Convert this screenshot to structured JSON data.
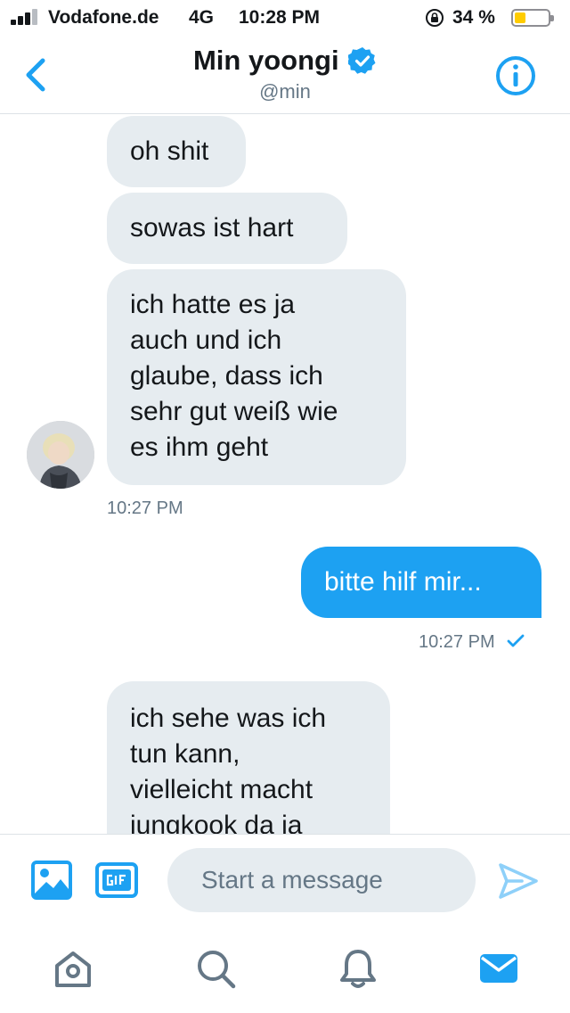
{
  "status_bar": {
    "carrier": "Vodafone.de",
    "network": "4G",
    "time": "10:28 PM",
    "battery_percent": "34 %",
    "battery_level": 0.34,
    "battery_color": "#ffcc00"
  },
  "header": {
    "title": "Min yoongi",
    "handle": "@min",
    "accent": "#1da1f2"
  },
  "messages": [
    {
      "direction": "received",
      "text": "oh shit"
    },
    {
      "direction": "received",
      "text": "sowas ist hart"
    },
    {
      "direction": "received",
      "lines": [
        "ich hatte es ja",
        "auch und ich",
        "glaube, dass ich",
        "sehr gut weiß wie",
        "es ihm geht"
      ]
    },
    {
      "direction": "received_timestamp",
      "text": "10:27 PM"
    },
    {
      "direction": "sent",
      "text": "bitte hilf mir..."
    },
    {
      "direction": "sent_timestamp",
      "text": "10:27 PM"
    },
    {
      "direction": "received",
      "lines": [
        "ich sehe was ich",
        "tun kann,",
        "vielleicht macht",
        "jungkook da ja"
      ]
    }
  ],
  "composer": {
    "placeholder": "Start a message",
    "icons": [
      "image-icon",
      "gif-icon",
      "send-icon"
    ]
  },
  "tab_bar": {
    "icons": [
      "home-icon",
      "search-icon",
      "notifications-icon",
      "messages-icon"
    ],
    "active": "messages-icon"
  }
}
